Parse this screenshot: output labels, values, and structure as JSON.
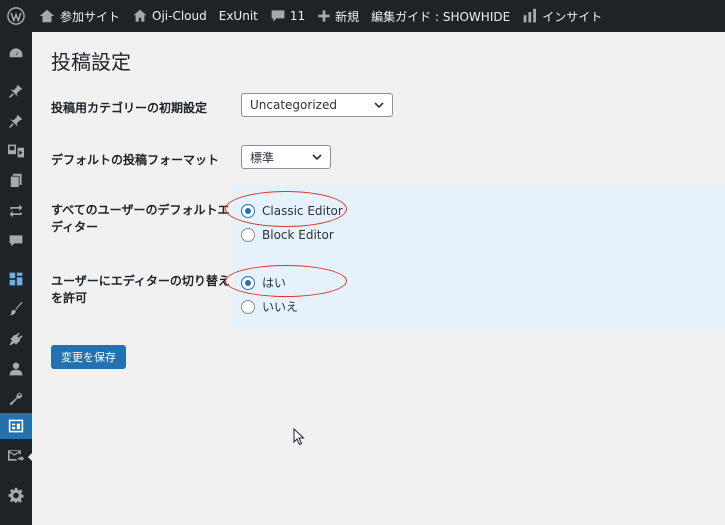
{
  "adminbar": {
    "site_name": "参加サイト",
    "site_home": "Oji-Cloud",
    "exunit": "ExUnit",
    "comments_count": "11",
    "new_label": "新規",
    "edit_guide": "編集ガイド : SHOWHIDE",
    "insight": "インサイト"
  },
  "page": {
    "title": "投稿設定"
  },
  "settings": {
    "default_category": {
      "label": "投稿用カテゴリーの初期設定",
      "value": "Uncategorized"
    },
    "default_format": {
      "label": "デフォルトの投稿フォーマット",
      "value": "標準"
    },
    "default_editor": {
      "label": "すべてのユーザーのデフォルトエディター",
      "options": [
        {
          "label": "Classic Editor",
          "checked": true
        },
        {
          "label": "Block Editor",
          "checked": false
        }
      ]
    },
    "allow_switch": {
      "label": "ユーザーにエディターの切り替えを許可",
      "options": [
        {
          "label": "はい",
          "checked": true
        },
        {
          "label": "いいえ",
          "checked": false
        }
      ]
    }
  },
  "actions": {
    "save_label": "変更を保存"
  },
  "colors": {
    "accent": "#2271b1",
    "adminbar_bg": "#1d2327",
    "highlight_bg": "#e5f1fb",
    "annotation": "#e0302a"
  }
}
